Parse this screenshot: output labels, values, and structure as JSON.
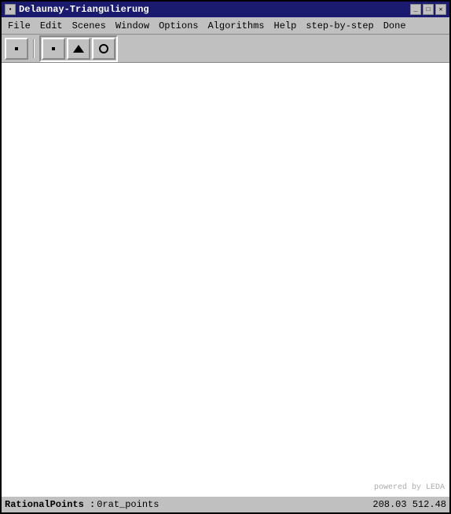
{
  "window": {
    "title": "Delaunay-Triangulierung",
    "icon": "▪"
  },
  "title_buttons": {
    "minimize": "_",
    "maximize": "□",
    "close": "✕"
  },
  "menu": {
    "items": [
      {
        "id": "file",
        "label": "File"
      },
      {
        "id": "edit",
        "label": "Edit"
      },
      {
        "id": "scenes",
        "label": "Scenes"
      },
      {
        "id": "window",
        "label": "Window"
      },
      {
        "id": "options",
        "label": "Options"
      },
      {
        "id": "algorithms",
        "label": "Algorithms"
      },
      {
        "id": "help",
        "label": "Help"
      },
      {
        "id": "step-by-step",
        "label": "step-by-step"
      },
      {
        "id": "done",
        "label": "Done"
      }
    ]
  },
  "toolbar": {
    "buttons": [
      {
        "id": "point-btn",
        "icon": "point"
      },
      {
        "id": "point2-btn",
        "icon": "point"
      },
      {
        "id": "triangle-btn",
        "icon": "triangle"
      },
      {
        "id": "circle-btn",
        "icon": "circle"
      }
    ]
  },
  "canvas": {
    "powered_by": "powered by LEDA"
  },
  "status_bar": {
    "label": "RationalPoints :",
    "value": "0rat_points",
    "coords": "208.03  512.48"
  }
}
